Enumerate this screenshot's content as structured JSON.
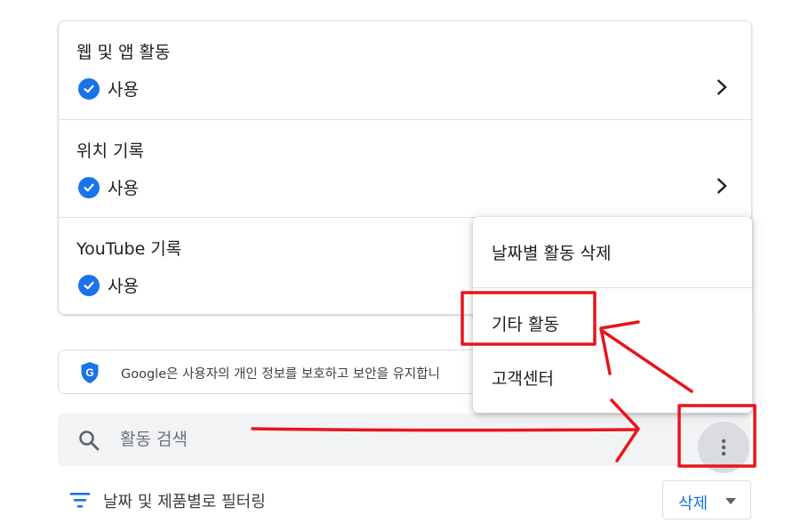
{
  "activity_controls": [
    {
      "title": "웹 및 앱 활동",
      "status": "사용"
    },
    {
      "title": "위치 기록",
      "status": "사용"
    },
    {
      "title": "YouTube 기록",
      "status": "사용"
    }
  ],
  "info_banner": {
    "text": "Google은 사용자의 개인 정보를 보호하고 보안을 유지합니"
  },
  "search": {
    "placeholder": "활동 검색"
  },
  "filter": {
    "label": "날짜 및 제품별로 필터링"
  },
  "delete_button": {
    "label": "삭제"
  },
  "menu": {
    "items": [
      {
        "label": "날짜별 활동 삭제"
      },
      {
        "label": "기타 활동"
      },
      {
        "label": "고객센터"
      }
    ]
  },
  "colors": {
    "accent": "#1a73e8",
    "annotation": "#e8141c"
  }
}
